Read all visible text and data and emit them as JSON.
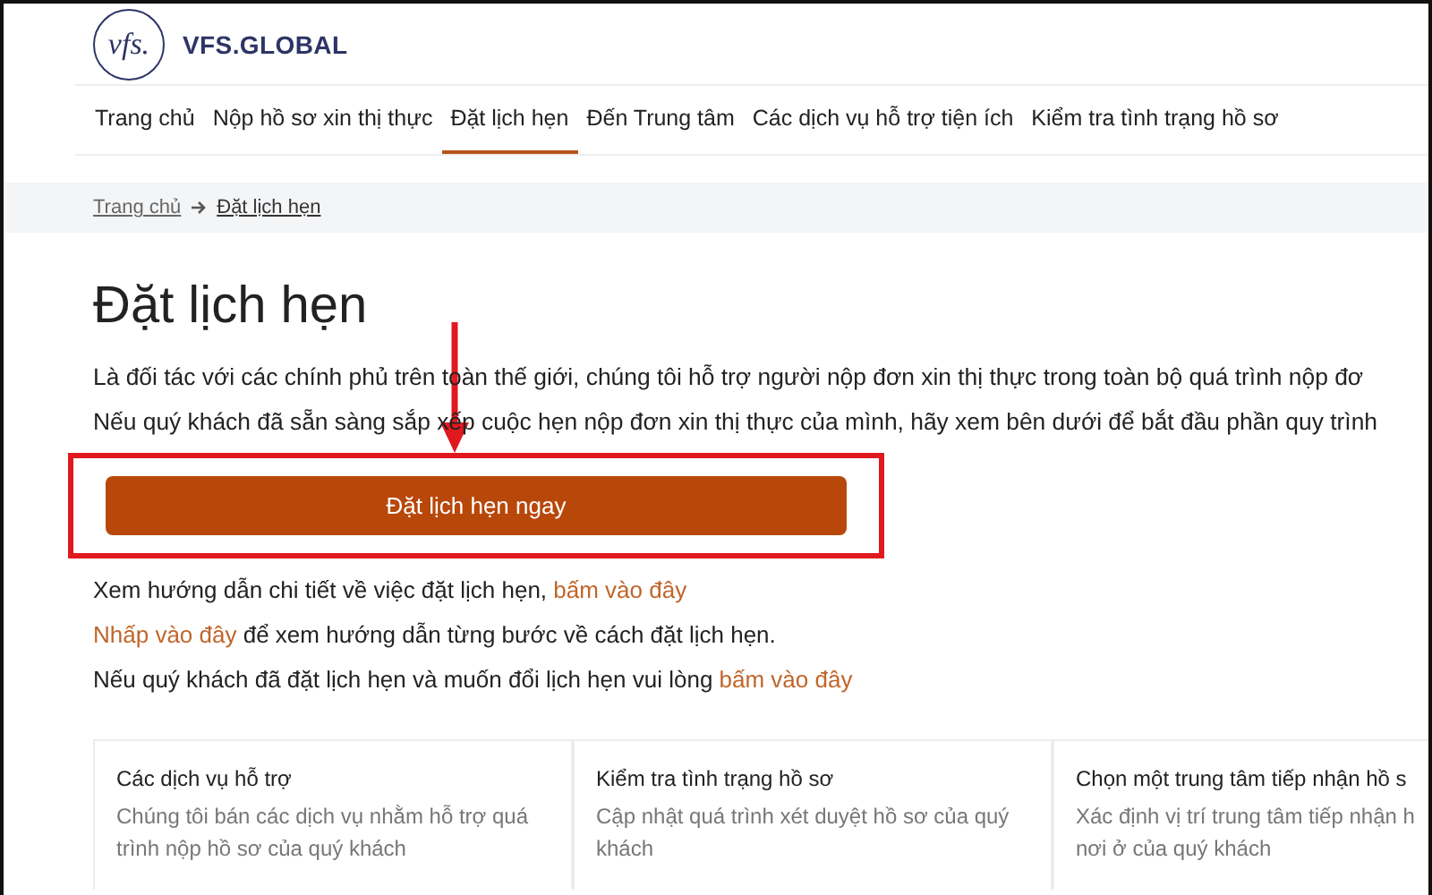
{
  "header": {
    "logo_mark": "vfs.",
    "brand": "VFS.GLOBAL"
  },
  "nav": [
    {
      "label": "Trang chủ",
      "selected": false
    },
    {
      "label": "Nộp hồ sơ xin thị thực",
      "selected": false
    },
    {
      "label": "Đặt lịch hẹn",
      "selected": true
    },
    {
      "label": "Đến Trung tâm",
      "selected": false
    },
    {
      "label": "Các dịch vụ hỗ trợ tiện ích",
      "selected": false
    },
    {
      "label": "Kiểm tra tình trạng hồ sơ",
      "selected": false
    }
  ],
  "breadcrumb": [
    "Trang chủ",
    "Đặt lịch hẹn"
  ],
  "title": "Đặt lịch hẹn",
  "intro": [
    "Là đối tác với các chính phủ trên toàn thế giới, chúng tôi hỗ trợ người nộp đơn xin thị thực trong toàn bộ quá trình nộp đơ",
    "Nếu quý khách đã sẵn sàng sắp xếp cuộc hẹn nộp đơn xin thị thực của mình, hãy xem bên dưới để bắt đầu phần quy trình"
  ],
  "primary_button": "Đặt lịch hẹn ngay",
  "links": [
    {
      "before": "Xem hướng dẫn chi tiết về việc đặt lịch hẹn, ",
      "link": "bấm vào đây"
    },
    {
      "link": "Nhấp vào đây",
      "after": " để xem hướng dẫn từng bước về cách đặt lịch hẹn."
    },
    {
      "before": "Nếu quý khách đã đặt lịch hẹn và muốn đổi lịch hẹn vui lòng ",
      "link": "bấm vào đây"
    }
  ],
  "cards": [
    {
      "title": "Các dịch vụ hỗ trợ",
      "text": [
        "Chúng tôi bán các dịch vụ nhằm hỗ trợ quá",
        "trình nộp hồ sơ của quý khách"
      ]
    },
    {
      "title": "Kiểm tra tình trạng hồ sơ",
      "text": [
        "Cập nhật quá trình xét duyệt hồ sơ của quý",
        "khách"
      ]
    },
    {
      "title": "Chọn một trung tâm tiếp nhận hồ s",
      "text": [
        "Xác định vị trí trung tâm tiếp nhận h",
        "nơi ở của quý khách"
      ]
    }
  ]
}
